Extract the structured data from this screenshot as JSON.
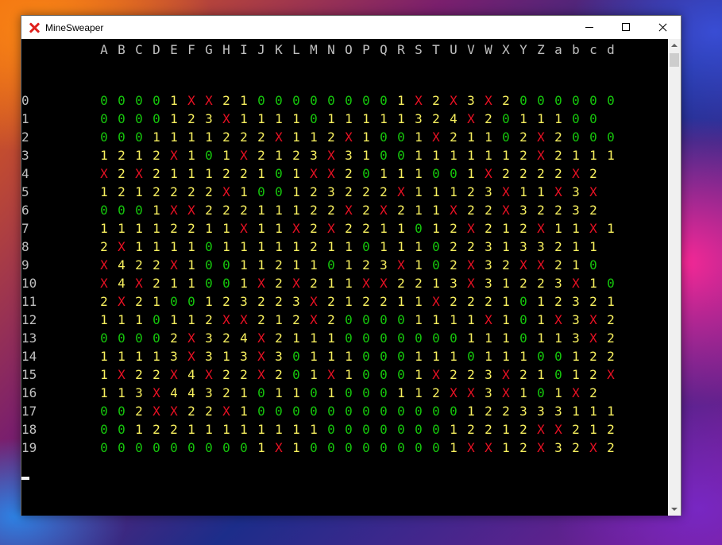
{
  "window": {
    "title": "MineSweaper",
    "controls": [
      "minimize",
      "maximize",
      "close"
    ]
  },
  "colors": {
    "zero": "#16c60c",
    "number": "#f9f15f",
    "mine": "#e81123",
    "label": "#c0c0c0",
    "console_bg": "#000000"
  },
  "board": {
    "columns": [
      "A",
      "B",
      "C",
      "D",
      "E",
      "F",
      "G",
      "H",
      "I",
      "J",
      "K",
      "L",
      "M",
      "N",
      "O",
      "P",
      "Q",
      "R",
      "S",
      "T",
      "U",
      "V",
      "W",
      "X",
      "Y",
      "Z",
      "a",
      "b",
      "c",
      "d"
    ],
    "row_labels": [
      "0",
      "1",
      "2",
      "3",
      "4",
      "5",
      "6",
      "7",
      "8",
      "9",
      "10",
      "11",
      "12",
      "13",
      "14",
      "15",
      "16",
      "17",
      "18",
      "19"
    ],
    "rows": [
      "00001XX21000000001X2X3X2000000",
      "000012 3X1111011111324X2011100",
      "000111122 2X112X1001X21102X2000",
      "1212X101X2123X31001111112X2111",
      "X2X2111221 01XX201110 01X2222X2",
      "1212222X1001 23222X11123X11X3X",
      "0001XX2221112 2X2X211X22X32232",
      "11112211X11X2X221 1012X212X11X1",
      "2X1111 01111121101110223133211",
      "X422X1001121101 23X102X32XX210",
      "X4X2110 01X2X211XX2213X31223X10",
      "2X2100123223X212211X2221012321",
      "111011 2XX212X200001111X101X3X2",
      "00002X324X21110000000111011 3X2",
      "11113X313X301110001110111001 22",
      "1X22X4X22X201X1 0001X223X21012X",
      "113X4432101 1010001 12XX3X101X2",
      "002XX22X1000000000000122333111 1",
      "00122111111110000000122 12XX2121",
      "0000000001X1000000001XX12X32X2X"
    ]
  }
}
